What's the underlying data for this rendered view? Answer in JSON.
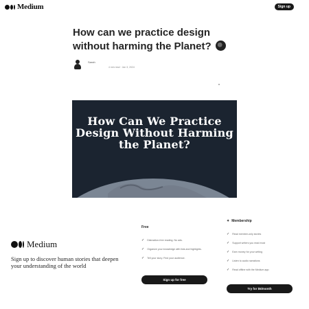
{
  "header": {
    "logo_text": "Medium",
    "signup_label": "Sign up"
  },
  "article": {
    "title": "How can we practice design without harming the Planet?",
    "author": "Sarah",
    "meta": "4 min read · Jan 3, 2024",
    "hero_text": "How Can We Practice Design Without Harming the Planet?"
  },
  "overlay": {
    "logo_text": "Medium",
    "tagline": "Sign up to discover human stories that deepen your understanding of the world",
    "free": {
      "title": "Free",
      "items": [
        "Distraction-free reading. No ads.",
        "Organize your knowledge with lists and highlights.",
        "Tell your story. Find your audience."
      ],
      "button_label": "Sign up for free"
    },
    "membership": {
      "title": "Membership",
      "items": [
        "Read member-only stories",
        "Support writers you read most",
        "Earn money for your writing",
        "Listen to audio narrations",
        "Read offline with the Medium app"
      ],
      "button_label": "Try for $5/month"
    }
  },
  "colors": {
    "accent": "#191919",
    "hero_bg": "#1b2430"
  },
  "icons": [
    "medium-logo-icon",
    "globe-icon",
    "avatar-icon",
    "check-icon",
    "star-icon",
    "earth-icon"
  ]
}
